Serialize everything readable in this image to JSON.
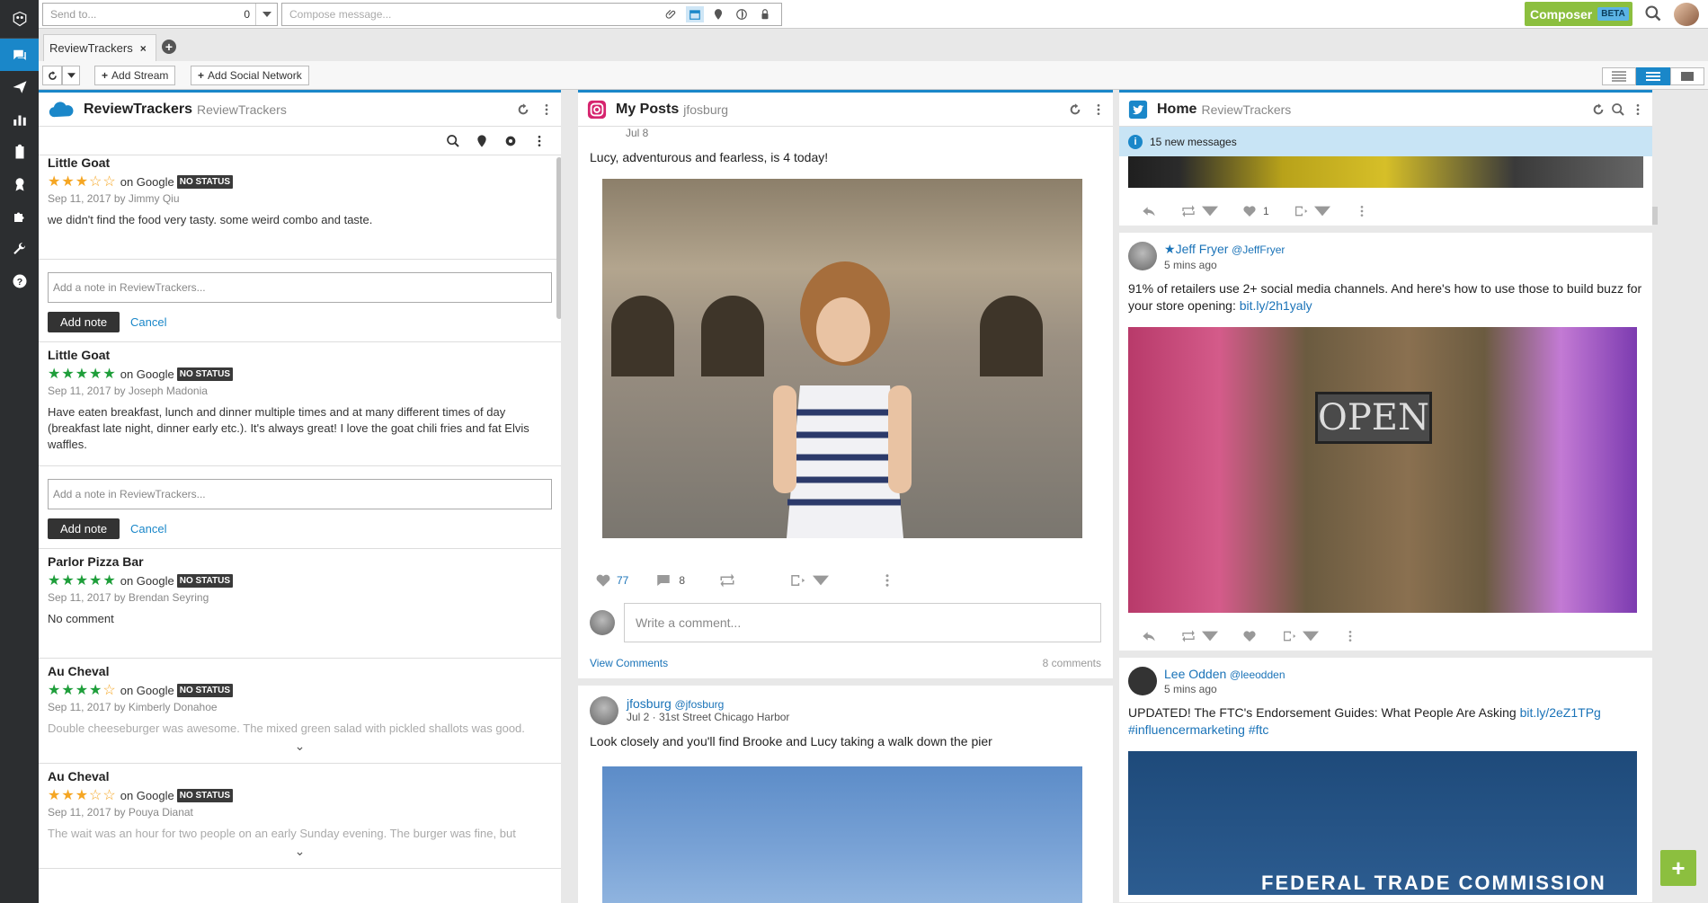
{
  "topbar": {
    "send_to_placeholder": "Send to...",
    "send_to_count": "0",
    "compose_placeholder": "Compose message...",
    "composer_label": "Composer",
    "beta_label": "BETA"
  },
  "tabs": [
    {
      "label": "ReviewTrackers",
      "close": "×"
    }
  ],
  "tab_add": "+",
  "toolbar": {
    "add_stream": "Add Stream",
    "add_social_network": "Add Social Network"
  },
  "columns": {
    "reviews": {
      "title": "ReviewTrackers",
      "subtitle": "ReviewTrackers",
      "items": [
        {
          "name": "Little Goat",
          "stars": 3,
          "color": "gold",
          "on": "on Google",
          "status": "NO STATUS",
          "meta": "Sep 11, 2017 by Jimmy Qiu",
          "text": "we didn't find the food very tasty. some weird combo and taste."
        },
        {
          "name": "Little Goat",
          "stars": 5,
          "color": "green",
          "on": "on Google",
          "status": "NO STATUS",
          "meta": "Sep 11, 2017 by Joseph Madonia",
          "text": "Have eaten breakfast, lunch and dinner multiple times and at many different times of day (breakfast late night, dinner early etc.). It's always great! I love the goat chili fries and fat Elvis waffles."
        },
        {
          "name": "Parlor Pizza Bar",
          "stars": 5,
          "color": "green",
          "on": "on Google",
          "status": "NO STATUS",
          "meta": "Sep 11, 2017 by Brendan Seyring",
          "text": "No comment"
        },
        {
          "name": "Au Cheval",
          "stars": 4,
          "color": "green",
          "on": "on Google",
          "status": "NO STATUS",
          "meta": "Sep 11, 2017 by Kimberly Donahoe",
          "text": "Double cheeseburger was awesome. The mixed green salad with pickled shallots was good."
        },
        {
          "name": "Au Cheval",
          "stars": 3,
          "color": "gold",
          "on": "on Google",
          "status": "NO STATUS",
          "meta": "Sep 11, 2017 by Pouya Dianat",
          "text": "The wait was an hour for two people on an early Sunday evening. The burger was fine, but"
        }
      ],
      "note_placeholder": "Add a note in ReviewTrackers...",
      "add_note": "Add note",
      "cancel": "Cancel"
    },
    "instagram": {
      "title": "My Posts",
      "subtitle": "jfosburg",
      "post1": {
        "date": "Jul 8",
        "caption": "Lucy, adventurous and fearless, is 4 today!",
        "likes": "77",
        "comments": "8",
        "comment_placeholder": "Write a comment...",
        "view_comments": "View Comments",
        "comments_count": "8 comments"
      },
      "post2": {
        "author": "jfosburg",
        "handle": "@jfosburg",
        "meta": "Jul 2 · 31st Street Chicago Harbor",
        "caption": "Look closely and you'll find Brooke and Lucy taking a walk down the pier"
      }
    },
    "twitter": {
      "title": "Home",
      "subtitle": "ReviewTrackers",
      "banner": "15 new messages",
      "top_likes": "1",
      "tweets": [
        {
          "name": "Jeff Fryer",
          "handle": "@JeffFryer",
          "time": "5 mins ago",
          "text": "91% of retailers use 2+ social media channels. And here's how to use those to build buzz for your store opening: ",
          "link": "bit.ly/2h1yaly",
          "sign": "OPEN"
        },
        {
          "name": "Lee Odden",
          "handle": "@leeodden",
          "time": "5 mins ago",
          "text": "UPDATED! The FTC's Endorsement Guides: What People Are Asking ",
          "link": "bit.ly/2eZ1TPg",
          "tags": "#influencermarketing #ftc",
          "image_text": "FEDERAL TRADE COMMISSION"
        }
      ]
    }
  },
  "fab": "+"
}
